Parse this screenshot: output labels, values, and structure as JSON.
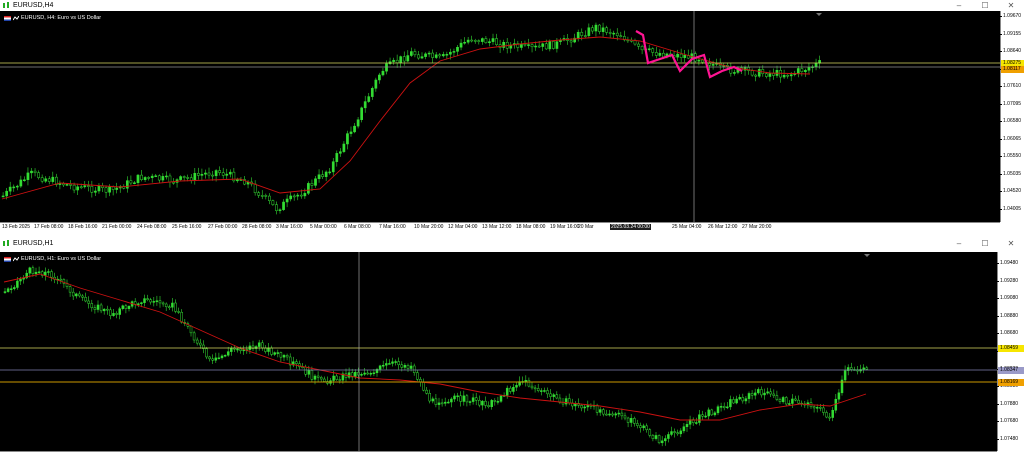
{
  "colors": {
    "candle": "#33dd33",
    "ma": "#cc1111",
    "pink": "#ff1493",
    "yellow": "#d8d860",
    "gold": "#cc9900",
    "lavender": "#8080b0",
    "grey": "#909090"
  },
  "window1": {
    "title": "EURUSD,H4",
    "label": "EURUSD, H4:  Euro vs US Dollar",
    "price_ticks": [
      "1.09670",
      "1.09155",
      "1.08640",
      "1.08125",
      "1.07610",
      "1.07095",
      "1.06580",
      "1.06065",
      "1.05550",
      "1.05035",
      "1.04520",
      "1.04005"
    ],
    "price_labels": {
      "yellow": "1.08275",
      "gold": "1.08117"
    },
    "time_ticks": [
      "13 Feb 2025",
      "17 Feb 08:00",
      "18 Feb 16:00",
      "21 Feb 00:00",
      "24 Feb 08:00",
      "25 Feb 16:00",
      "27 Feb 00:00",
      "28 Feb 08:00",
      "3 Mar 16:00",
      "5 Mar 00:00",
      "6 Mar 08:00",
      "7 Mar 16:00",
      "10 Mar 20:00",
      "12 Mar 04:00",
      "13 Mar 12:00",
      "18 Mar 08:00",
      "19 Mar 16:00",
      "20 Mar",
      "2025.03.24 00:00",
      "25 Mar 04:00",
      "26 Mar 12:00",
      "27 Mar 20:00"
    ],
    "crosshair_time": "2025.03.24 00:00"
  },
  "window2": {
    "title": "EURUSD,H1",
    "label": "EURUSD, H1:  Euro vs US Dollar",
    "price_ticks": [
      "1.09480",
      "1.09280",
      "1.09080",
      "1.08880",
      "1.08680",
      "1.08480",
      "1.08280",
      "1.08080",
      "1.07880",
      "1.07680",
      "1.07480"
    ],
    "price_labels": {
      "yellow": "1.08459",
      "lavender": "1.08347",
      "gold": "1.08169"
    }
  },
  "controls": {
    "min": "–",
    "max": "☐",
    "close": "✕"
  }
}
